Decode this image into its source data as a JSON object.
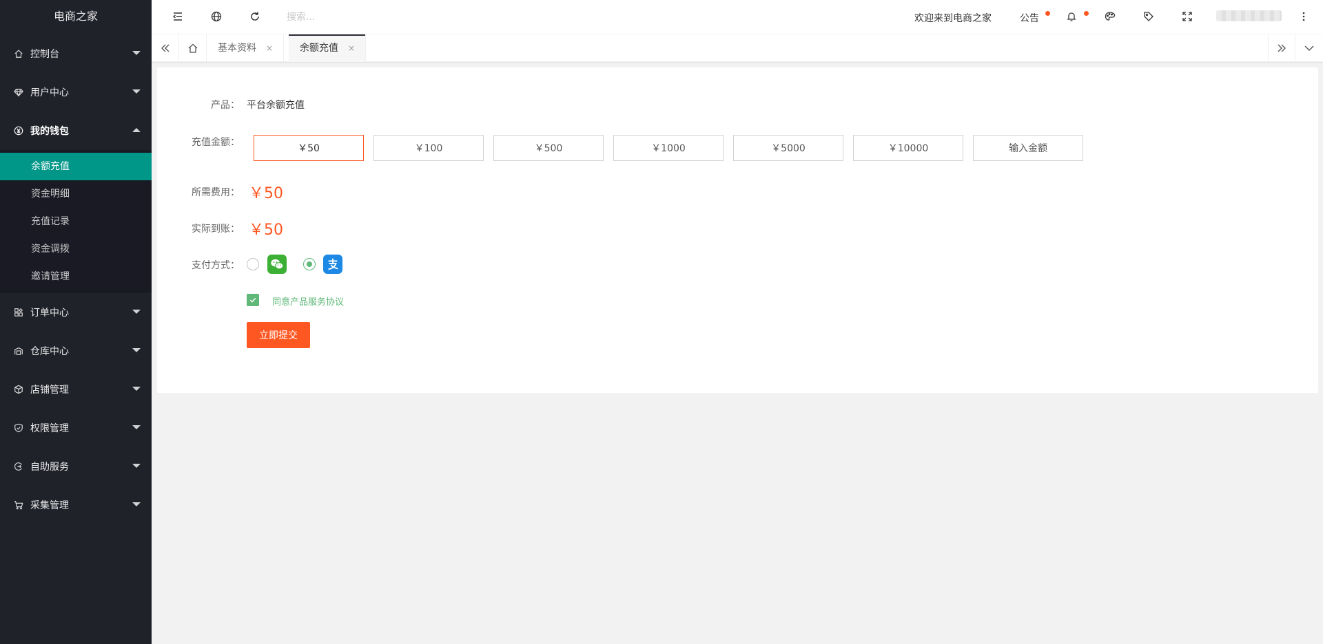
{
  "app": {
    "title": "电商之家"
  },
  "sidebar": {
    "items": [
      {
        "label": "控制台",
        "icon": "home-icon"
      },
      {
        "label": "用户中心",
        "icon": "diamond-icon"
      },
      {
        "label": "我的钱包",
        "icon": "yen-circle-icon",
        "open": true,
        "children": [
          "余额充值",
          "资金明细",
          "充值记录",
          "资金调拨",
          "邀请管理"
        ],
        "active_child": "余额充值"
      },
      {
        "label": "订单中心",
        "icon": "app-grid-icon"
      },
      {
        "label": "仓库中心",
        "icon": "warehouse-icon"
      },
      {
        "label": "店铺管理",
        "icon": "cube-icon"
      },
      {
        "label": "权限管理",
        "icon": "shield-icon"
      },
      {
        "label": "自助服务",
        "icon": "service-icon"
      },
      {
        "label": "采集管理",
        "icon": "cart-icon"
      }
    ]
  },
  "header": {
    "search_placeholder": "搜索...",
    "welcome": "欢迎来到电商之家",
    "notice": "公告",
    "accent": "#ff5722"
  },
  "tabs": {
    "items": [
      {
        "label": "基本资料",
        "close": "×"
      },
      {
        "label": "余额充值",
        "close": "×",
        "active": true
      }
    ]
  },
  "form": {
    "product_label": "产品：",
    "product_value": "平台余额充值",
    "amount_label": "充值金额：",
    "amounts": [
      "￥50",
      "￥100",
      "￥500",
      "￥1000",
      "￥5000",
      "￥10000",
      "输入金额"
    ],
    "selected_amount": "￥50",
    "fee_label": "所需费用：",
    "fee_value": "￥50",
    "actual_label": "实际到账：",
    "actual_value": "￥50",
    "pay_label": "支付方式：",
    "pay_methods": [
      {
        "name": "wechat-pay-icon",
        "selected": false,
        "color": "#3cb034"
      },
      {
        "name": "alipay-icon",
        "selected": true,
        "color": "#1e88e5"
      }
    ],
    "agree_text": "同意产品服务协议",
    "agree_checked": true,
    "submit_label": "立即提交"
  }
}
